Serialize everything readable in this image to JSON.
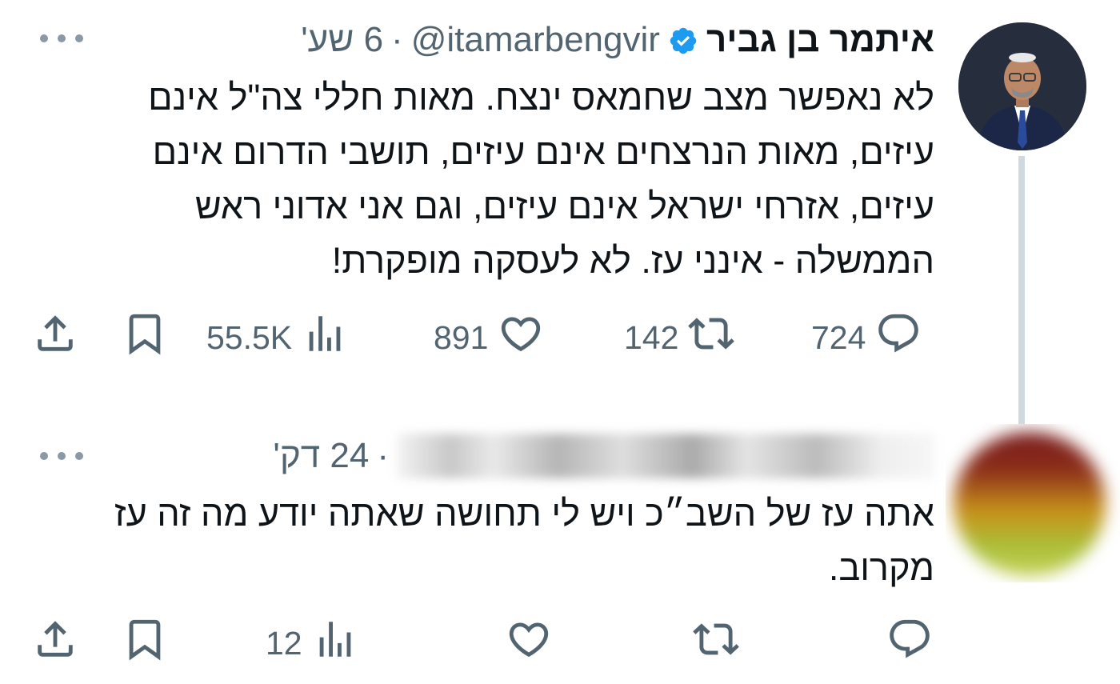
{
  "tweet": {
    "name": "איתמר בן גביר",
    "handle": "@itamarbengvir",
    "separator": "·",
    "time": "6 שע'",
    "text": "לא נאפשר מצב שחמאס ינצח. מאות חללי צה\"ל אינם עיזים, מאות הנרצחים אינם עיזים, תושבי הדרום אינם עיזים, אזרחי ישראל אינם עיזים, וגם אני אדוני ראש הממשלה - אינני עז. לא לעסקה מופקרת!",
    "stats": {
      "replies": "724",
      "retweets": "142",
      "likes": "891",
      "views": "55.5K"
    },
    "icons": [
      "reply-icon",
      "retweet-icon",
      "like-icon",
      "views-icon",
      "bookmark-icon",
      "share-icon",
      "verified-icon",
      "more-icon"
    ]
  },
  "reply": {
    "separator": "·",
    "time": "24 דק'",
    "text": "אתה עז של השב״כ ויש לי תחושה שאתה יודע מה זה עז מקרוב.",
    "stats": {
      "replies": "",
      "retweets": "",
      "likes": "",
      "views": "12"
    }
  },
  "colors": {
    "text": "#0f1419",
    "secondary": "#536471",
    "verified": "#1d9bf0",
    "thread_line": "#cfd9de"
  }
}
